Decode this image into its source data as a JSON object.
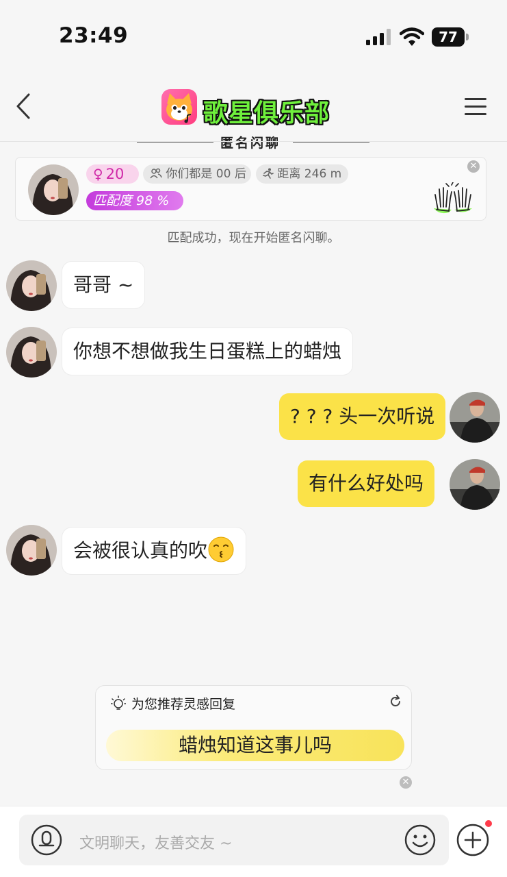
{
  "status_bar": {
    "time": "23:49",
    "battery": "77"
  },
  "nav": {
    "app_title": "歌星俱乐部",
    "subtitle": "匿名闪聊"
  },
  "match_card": {
    "age": "20",
    "age_symbol": "♀",
    "generation": "你们都是 00 后",
    "distance": "距离 246 m",
    "match_score": "匹配度 98 %"
  },
  "system_message": "匹配成功，现在开始匿名闪聊。",
  "messages": [
    {
      "side": "left",
      "text": "哥哥 ~"
    },
    {
      "side": "left",
      "text": "你想不想做我生日蛋糕上的蜡烛"
    },
    {
      "side": "right",
      "text": "? ? ? 头一次听说"
    },
    {
      "side": "right",
      "text": "有什么好处吗"
    },
    {
      "side": "left",
      "text": "会被很认真的吹",
      "emoji": "kissing-face-emoji"
    }
  ],
  "suggestion": {
    "title": "为您推荐灵感回复",
    "reply": "蜡烛知道这事儿吗"
  },
  "input": {
    "placeholder": "文明聊天，友善交友 ~"
  },
  "colors": {
    "accent_yellow": "#fbe248",
    "match_purple": "#c43bdc",
    "title_green": "#6ff03c",
    "badge_red": "#ff3b4a"
  }
}
